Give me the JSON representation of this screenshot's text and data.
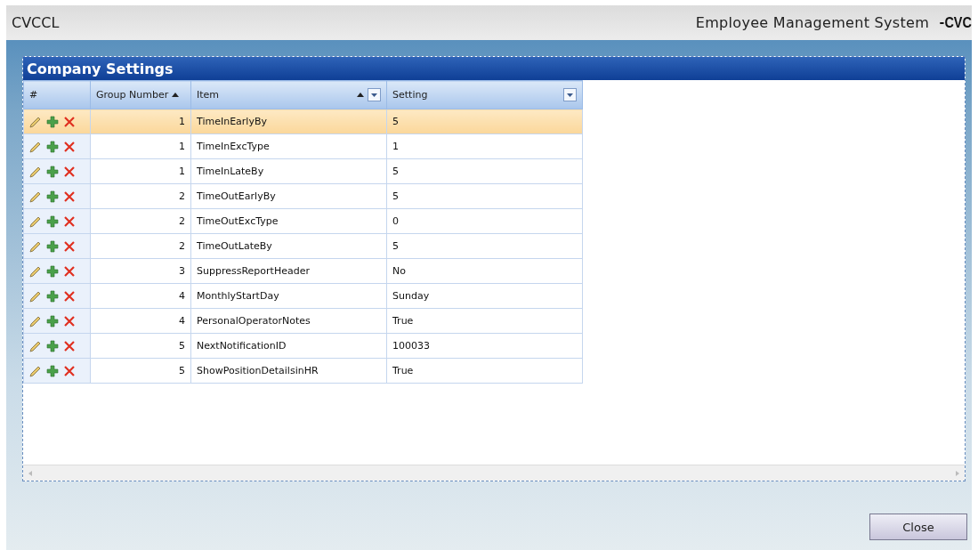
{
  "header": {
    "title": "CVCCL",
    "app_name": "Employee Management System",
    "logo": "CVC"
  },
  "panel": {
    "title": "Company Settings",
    "columns": [
      {
        "label": "#",
        "sorted": false,
        "filter": false
      },
      {
        "label": "Group Number",
        "sorted": true,
        "filter": false
      },
      {
        "label": "Item",
        "sorted": true,
        "filter": true
      },
      {
        "label": "Setting",
        "sorted": false,
        "filter": true
      }
    ],
    "rows": [
      {
        "group": "1",
        "item": "TimeInEarlyBy",
        "setting": "5",
        "selected": true
      },
      {
        "group": "1",
        "item": "TimeInExcType",
        "setting": "1",
        "selected": false
      },
      {
        "group": "1",
        "item": "TimeInLateBy",
        "setting": "5",
        "selected": false
      },
      {
        "group": "2",
        "item": "TimeOutEarlyBy",
        "setting": "5",
        "selected": false
      },
      {
        "group": "2",
        "item": "TimeOutExcType",
        "setting": "0",
        "selected": false
      },
      {
        "group": "2",
        "item": "TimeOutLateBy",
        "setting": "5",
        "selected": false
      },
      {
        "group": "3",
        "item": "SuppressReportHeader",
        "setting": "No",
        "selected": false
      },
      {
        "group": "4",
        "item": "MonthlyStartDay",
        "setting": "Sunday",
        "selected": false
      },
      {
        "group": "4",
        "item": "PersonalOperatorNotes",
        "setting": "True",
        "selected": false
      },
      {
        "group": "5",
        "item": "NextNotificationID",
        "setting": "100033",
        "selected": false
      },
      {
        "group": "5",
        "item": "ShowPositionDetailsinHR",
        "setting": "True",
        "selected": false
      }
    ]
  },
  "buttons": [
    {
      "label": "Close"
    }
  ]
}
